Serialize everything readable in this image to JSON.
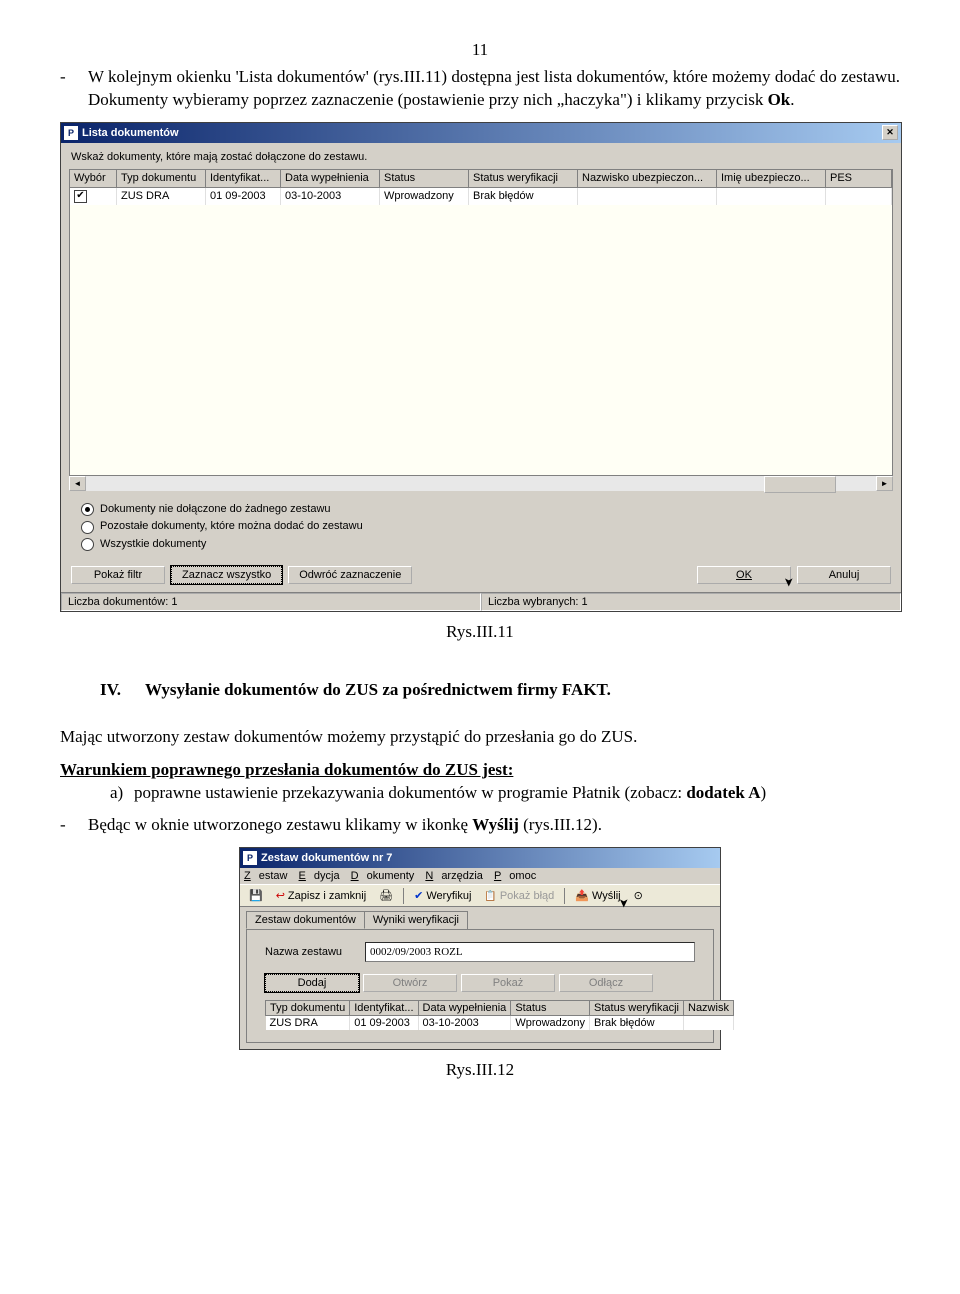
{
  "page_number": "11",
  "para1_a": "W kolejnym okienku 'Lista dokumentów' (rys.III.11) dostępna jest lista dokumentów, które możemy dodać do zestawu. Dokumenty wybieramy poprzez zaznaczenie (postawienie przy nich „haczyka\") i klikamy przycisk ",
  "para1_b": "Ok",
  "para1_c": ".",
  "dialog1": {
    "title": "Lista dokumentów",
    "instruction": "Wskaż dokumenty, które mają zostać dołączone do zestawu.",
    "headers": [
      "Wybór",
      "Typ dokumentu",
      "Identyfikat...",
      "Data wypełnienia",
      "Status",
      "Status weryfikacji",
      "Nazwisko ubezpieczon...",
      "Imię ubezpieczo...",
      "PES"
    ],
    "row": {
      "checked": "✔",
      "typ": "ZUS DRA",
      "ident": "01 09-2003",
      "data": "03-10-2003",
      "status": "Wprowadzony",
      "weryf": "Brak błędów",
      "nazw": "",
      "imie": "",
      "pes": ""
    },
    "radio1": "Dokumenty nie dołączone do żadnego zestawu",
    "radio2": "Pozostałe dokumenty, które można dodać do zestawu",
    "radio3": "Wszystkie dokumenty",
    "btn_filter": "Pokaż filtr",
    "btn_selall": "Zaznacz wszystko",
    "btn_invert": "Odwróć zaznaczenie",
    "btn_ok": "OK",
    "btn_cancel": "Anuluj",
    "status_left": "Liczba dokumentów: 1",
    "status_right": "Liczba wybranych: 1"
  },
  "caption1": "Rys.III.11",
  "section_num": "IV.",
  "section_title": "Wysyłanie dokumentów do ZUS za pośrednictwem firmy FAKT.",
  "para2": "Mając utworzony zestaw dokumentów możemy przystąpić do przesłania go do ZUS.",
  "cond_head": "Warunkiem poprawnego przesłania dokumentów do ZUS jest:",
  "cond_a_label": "a)",
  "cond_a": "poprawne ustawienie przekazywania dokumentów w programie Płatnik (zobacz: ",
  "cond_a_b": "dodatek A",
  "cond_a_c": ")",
  "para3_a": "Będąc w oknie utworzonego zestawu klikamy w ikonkę ",
  "para3_b": "Wyślij",
  "para3_c": " (rys.III.12).",
  "dialog2": {
    "title": "Zestaw dokumentów nr 7",
    "menu": [
      "Zestaw",
      "Edycja",
      "Dokumenty",
      "Narzędzia",
      "Pomoc"
    ],
    "tb_save": "Zapisz i zamknij",
    "tb_verify": "Weryfikuj",
    "tb_err": "Pokaż błąd",
    "tb_send": "Wyślij",
    "tab1": "Zestaw dokumentów",
    "tab2": "Wyniki weryfikacji",
    "label_name": "Nazwa zestawu",
    "value_name": "0002/09/2003 ROZL",
    "btn_add": "Dodaj",
    "btn_open": "Otwórz",
    "btn_show": "Pokaż",
    "btn_detach": "Odłącz",
    "headers": [
      "Typ dokumentu",
      "Identyfikat...",
      "Data wypełnienia",
      "Status",
      "Status weryfikacji",
      "Nazwisk"
    ],
    "row": {
      "typ": "ZUS DRA",
      "ident": "01 09-2003",
      "data": "03-10-2003",
      "status": "Wprowadzony",
      "weryf": "Brak błędów",
      "nazw": ""
    }
  },
  "caption2": "Rys.III.12"
}
